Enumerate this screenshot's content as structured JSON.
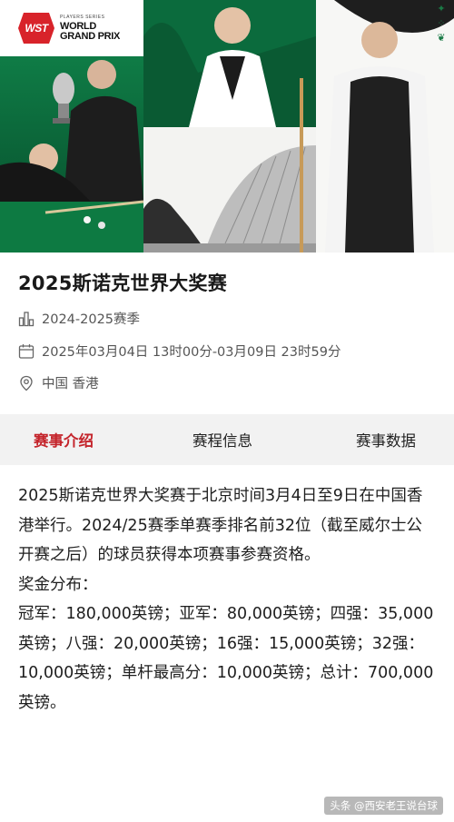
{
  "hero": {
    "logo_badge": "WST",
    "logo_small": "PLAYERS SERIES",
    "logo_line1": "WORLD",
    "logo_line2": "GRAND PRIX",
    "icons": [
      "sparkle-icon",
      "dots-icon",
      "leaf-icon"
    ]
  },
  "event": {
    "title": "2025斯诺克世界大奖赛",
    "season": "2024-2025赛季",
    "date": "2025年03月04日 13时00分-03月09日 23时59分",
    "location": "中国 香港"
  },
  "tabs": [
    {
      "label": "赛事介绍",
      "active": true
    },
    {
      "label": "赛程信息",
      "active": false
    },
    {
      "label": "赛事数据",
      "active": false
    }
  ],
  "content": {
    "intro": "2025斯诺克世界大奖赛于北京时间3月4日至9日在中国香港举行。2024/25赛季单赛季排名前32位（截至威尔士公开赛之后）的球员获得本项赛事参赛资格。",
    "prize_heading": "奖金分布：",
    "prize_text": "冠军：180,000英镑；亚军：80,000英镑；四强：35,000英镑；八强：20,000英镑；16强：15,000英镑；32强：10,000英镑；单杆最高分：10,000英镑；总计：700,000英镑。"
  },
  "watermark": "头条 @西安老王说台球",
  "colors": {
    "accent_red": "#c4242b",
    "tab_bar_bg": "#f2f2f2",
    "hero_green": "#0b6b3d"
  }
}
